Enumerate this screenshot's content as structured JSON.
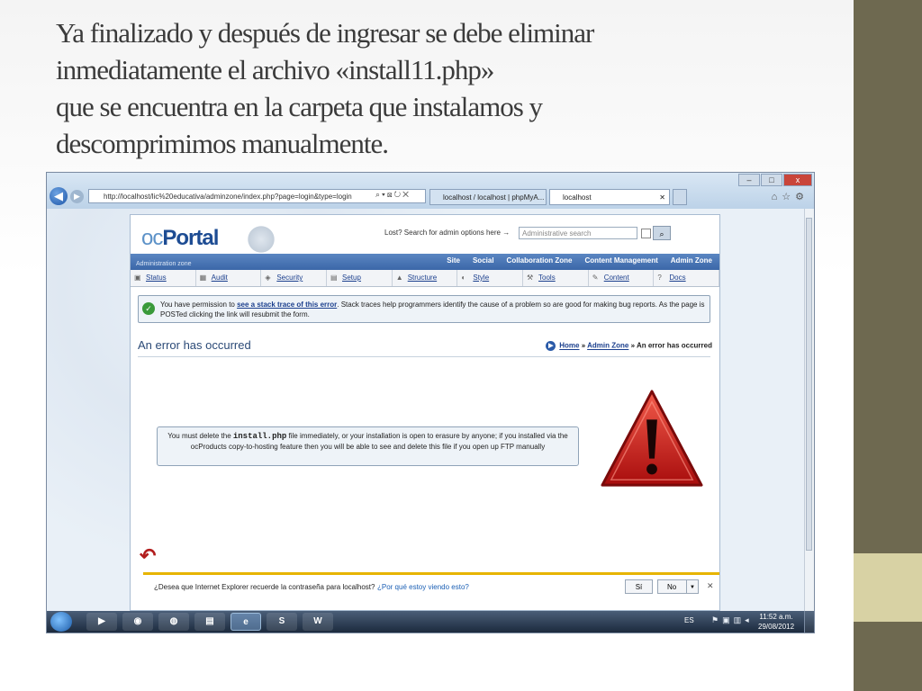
{
  "slide": {
    "title_lines": [
      "Ya finalizado y después de ingresar se debe eliminar",
      "inmediatamente el archivo «install11.php»",
      "que se encuentra en la carpeta que instalamos y",
      "descomprimimos manualmente."
    ]
  },
  "browser": {
    "address": "http://localhost/lic%20educativa/adminzone/index.php?page=login&type=login",
    "tabs": [
      {
        "label": "localhost / localhost | phpMyA..."
      },
      {
        "label": "localhost"
      }
    ],
    "window_controls": [
      "–",
      "□",
      "x"
    ]
  },
  "site": {
    "logo_prefix": "oc",
    "logo_main": "Portal",
    "search_hint": "Lost? Search for admin options here →",
    "search_placeholder": "Administrative search",
    "zone_label": "Administration zone",
    "zones": [
      "Site",
      "Social",
      "Collaboration Zone",
      "Content Management",
      "Admin Zone"
    ],
    "toolbar": [
      "Status",
      "Audit",
      "Security",
      "Setup",
      "Structure",
      "Style",
      "Tools",
      "Content",
      "Docs"
    ],
    "notice": {
      "before": "You have permission to ",
      "link": "see a stack trace of this error",
      "after": ". Stack traces help programmers identify the cause of a problem so are good for making bug reports. As the page is POSTed clicking the link will resubmit the form."
    },
    "error_title": "An error has occurred",
    "breadcrumb": {
      "home": "Home",
      "sep": "»",
      "admin": "Admin Zone",
      "current": "An error has occurred"
    },
    "message": {
      "before": "You must delete the ",
      "code": "install.php",
      "after": " file immediately, or your installation is open to erasure by anyone; if you installed via the ocProducts copy-to-hosting feature then you will be able to see and delete this file if you open up FTP manually"
    }
  },
  "password_bar": {
    "question": "¿Desea que Internet Explorer recuerde la contraseña para localhost?",
    "why": "¿Por qué estoy viendo esto?",
    "yes": "Sí",
    "no": "No"
  },
  "taskbar": {
    "apps": [
      "media",
      "chrome",
      "firefox",
      "explorer",
      "ie",
      "skype",
      "word"
    ],
    "app_glyphs": [
      "▶",
      "◉",
      "◍",
      "▤",
      "e",
      "S",
      "W"
    ],
    "language": "ES",
    "time": "11:52 a.m.",
    "date": "29/08/2012"
  },
  "colors": {
    "accent_olive": "#6e6950",
    "accent_sand": "#d8d2a4",
    "warning_red": "#c81a1a",
    "link_blue": "#1b3f8d"
  }
}
